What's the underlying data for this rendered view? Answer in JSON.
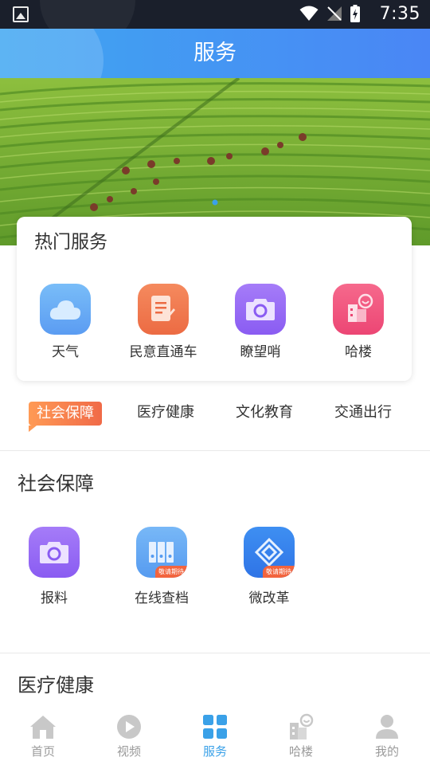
{
  "status_bar": {
    "time": "7:35"
  },
  "header": {
    "title": "服务"
  },
  "banner": {
    "active_index": 0
  },
  "hot_services": {
    "title": "热门服务",
    "items": [
      {
        "label": "天气",
        "icon": "cloud-icon",
        "color": "#6aaef5"
      },
      {
        "label": "民意直通车",
        "icon": "document-edit-icon",
        "color": "#f07a4f"
      },
      {
        "label": "瞭望哨",
        "icon": "camera-icon",
        "color": "#9a6ef5"
      },
      {
        "label": "哈楼",
        "icon": "building-smile-icon",
        "color": "#f0557a"
      }
    ]
  },
  "categories": {
    "items": [
      "社会保障",
      "医疗健康",
      "文化教育",
      "交通出行"
    ],
    "active": "社会保障"
  },
  "sections": [
    {
      "title": "社会保障",
      "items": [
        {
          "label": "报料",
          "icon": "camera-icon",
          "tag": ""
        },
        {
          "label": "在线查档",
          "icon": "archive-folders-icon",
          "tag": "敬请期待"
        },
        {
          "label": "微改革",
          "icon": "diamond-layers-icon",
          "tag": "敬请期待"
        }
      ]
    },
    {
      "title": "医疗健康"
    }
  ],
  "tabbar": {
    "items": [
      {
        "label": "首页",
        "icon": "home-icon"
      },
      {
        "label": "视频",
        "icon": "play-circle-icon"
      },
      {
        "label": "服务",
        "icon": "grid-icon"
      },
      {
        "label": "哈楼",
        "icon": "building-smile-icon"
      },
      {
        "label": "我的",
        "icon": "user-icon"
      }
    ],
    "active": "服务",
    "active_color": "#3aa1e8",
    "inactive_color": "#9a9a9a"
  }
}
